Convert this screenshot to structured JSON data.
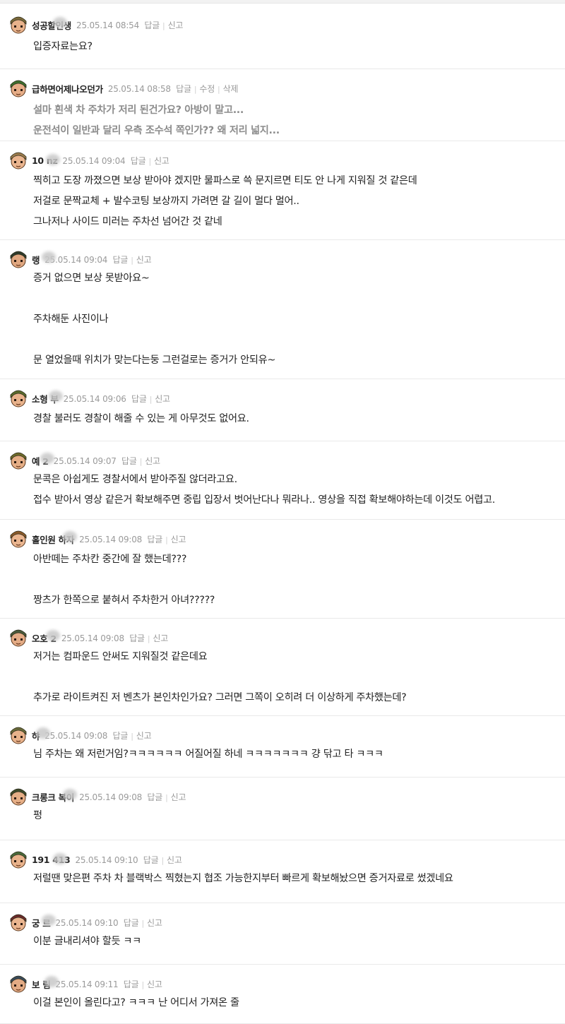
{
  "comments": [
    {
      "nickname": "성공할인생",
      "time": "25.05.14 08:54",
      "actions": [
        "답글",
        "신고"
      ],
      "lines": [
        "입증자료는요?"
      ],
      "avatar": "tan-helmet-avatar-icon"
    },
    {
      "nickname": "급하면어제나오던가",
      "time": "25.05.14 08:58",
      "actions": [
        "답글",
        "수정",
        "삭제"
      ],
      "lines": [
        "설마 흰색 차 주차가 저리 된건가요? 아방이 말고...",
        "운전석이 일반과 달리 우측 조수석 쪽인가?? 왜 저리 넓지..."
      ],
      "style": "gray",
      "avatar": "green-helmet-avatar-icon"
    },
    {
      "nickname": "10 nz",
      "time": "25.05.14 09:04",
      "actions": [
        "답글",
        "신고"
      ],
      "lines": [
        "찍히고 도장 까졌으면 보상 받아야 겠지만 물파스로 쓱 문지르면 티도 안 나게 지워질 것 같은데",
        "저걸로 문짝교체 + 발수코팅 보상까지 가려면 갈 길이 멀다 멀어..",
        "그나저나 사이드 미러는 주차선 넘어간 것 같네"
      ],
      "avatar": "tan-cap-avatar-icon"
    },
    {
      "nickname": "랭",
      "time": "25.05.14 09:04",
      "actions": [
        "답글",
        "신고"
      ],
      "lines": [
        "증거 없으면 보상 못받아요~",
        "",
        "주차해둔 사진이나",
        "",
        "문 열었을때 위치가 맞는다는둥 그런걸로는 증거가 안되유~"
      ],
      "avatar": "dark-helmet-avatar-icon"
    },
    {
      "nickname": "소형 부",
      "time": "25.05.14 09:06",
      "actions": [
        "답글",
        "신고"
      ],
      "lines": [
        "경찰 불러도 경찰이 해줄 수 있는 게 아무것도 없어요."
      ],
      "avatar": "olive-helmet-avatar-icon"
    },
    {
      "nickname": "예 2",
      "time": "25.05.14 09:07",
      "actions": [
        "답글",
        "신고"
      ],
      "lines": [
        "문콕은 아쉽게도 경찰서에서 받아주질 않더라고요.",
        "접수 받아서 영상 같은거 확보해주면 중립 입장서 벗어난다나 뭐라나.. 영상을 직접 확보해야하는데 이것도 어렵고."
      ],
      "avatar": "striped-helmet-avatar-icon"
    },
    {
      "nickname": "홀인원 하자",
      "time": "25.05.14 09:08",
      "actions": [
        "답글",
        "신고"
      ],
      "lines": [
        "아반떼는 주차칸 중간에 잘 했는데???",
        "",
        "짱츠가 한쪽으로 붙혀서 주차한거 아녀?????"
      ],
      "avatar": "brown-cap-avatar-icon"
    },
    {
      "nickname": "오호 2",
      "time": "25.05.14 09:08",
      "actions": [
        "답글",
        "신고"
      ],
      "lines": [
        "저거는 컴파운드 안써도 지워질것 같은데요",
        "",
        "추가로 라이트켜진 저 벤츠가 본인차인가요? 그러면 그쪽이 오히려 더 이상하게 주차했는데?"
      ],
      "avatar": "camo-helmet-avatar-icon"
    },
    {
      "nickname": "햐",
      "time": "25.05.14 09:08",
      "actions": [
        "답글",
        "신고"
      ],
      "lines": [
        "님 주차는 왜 저런거임?ㅋㅋㅋㅋㅋㅋ 어질어질 하네 ㅋㅋㅋㅋㅋㅋㅋ 걍 닦고 타 ㅋㅋㅋ"
      ],
      "avatar": "olive-cap-avatar-icon"
    },
    {
      "nickname": "크롱크 복이",
      "time": "25.05.14 09:08",
      "actions": [
        "답글",
        "신고"
      ],
      "lines": [
        "펑"
      ],
      "avatar": "dark-olive-helmet-avatar-icon"
    },
    {
      "nickname": "191 413",
      "time": "25.05.14 09:10",
      "actions": [
        "답글",
        "신고"
      ],
      "lines": [
        "저럴땐 맞은편 주차 차 블랙박스 찍혔는지 협조 가능한지부터 빠르게 확보해놨으면 증거자료로 썼겠네요"
      ],
      "avatar": "green-cap-avatar-icon"
    },
    {
      "nickname": "궁 르",
      "time": "25.05.14 09:10",
      "actions": [
        "답글",
        "신고"
      ],
      "lines": [
        "이분 글내리셔야 할듯 ㅋㅋ"
      ],
      "avatar": "maroon-hair-avatar-icon"
    },
    {
      "nickname": "보 림",
      "time": "25.05.14 09:11",
      "actions": [
        "답글",
        "신고"
      ],
      "lines": [
        "이걸 본인이 올린다고? ㅋㅋㅋ 난 어디서 가져온 줄"
      ],
      "avatar": "glasses-helmet-avatar-icon"
    }
  ]
}
